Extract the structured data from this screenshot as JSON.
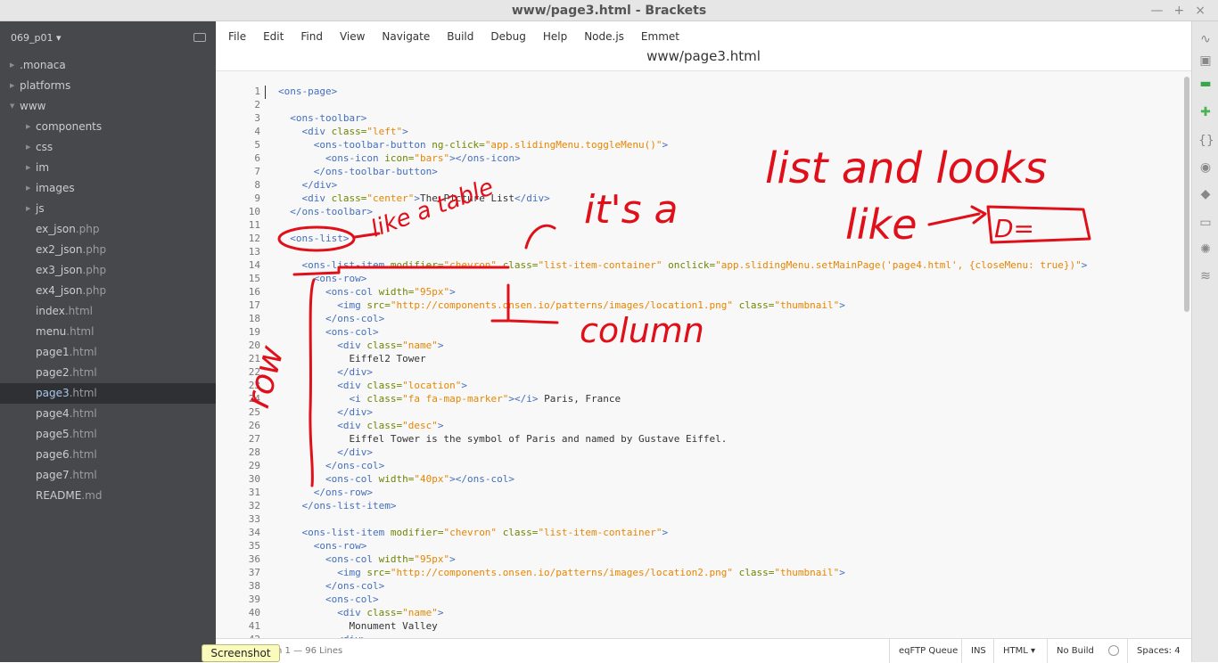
{
  "window": {
    "title": "www/page3.html - Brackets",
    "controls": [
      "—",
      "+",
      "×"
    ]
  },
  "sidebar": {
    "project": "069_p01 ▾",
    "items": [
      {
        "label": ".monaca",
        "type": "folder",
        "depth": 0,
        "open": false
      },
      {
        "label": "platforms",
        "type": "folder",
        "depth": 0,
        "open": false
      },
      {
        "label": "www",
        "type": "folder",
        "depth": 0,
        "open": true
      },
      {
        "label": "components",
        "type": "folder",
        "depth": 1,
        "open": false
      },
      {
        "label": "css",
        "type": "folder",
        "depth": 1,
        "open": false
      },
      {
        "label": "im",
        "type": "folder",
        "depth": 1,
        "open": false
      },
      {
        "label": "images",
        "type": "folder",
        "depth": 1,
        "open": false
      },
      {
        "label": "js",
        "type": "folder",
        "depth": 1,
        "open": false
      },
      {
        "name": "ex_json",
        "ext": ".php",
        "type": "file",
        "depth": 1
      },
      {
        "name": "ex2_json",
        "ext": ".php",
        "type": "file",
        "depth": 1
      },
      {
        "name": "ex3_json",
        "ext": ".php",
        "type": "file",
        "depth": 1
      },
      {
        "name": "ex4_json",
        "ext": ".php",
        "type": "file",
        "depth": 1
      },
      {
        "name": "index",
        "ext": ".html",
        "type": "file",
        "depth": 1
      },
      {
        "name": "menu",
        "ext": ".html",
        "type": "file",
        "depth": 1
      },
      {
        "name": "page1",
        "ext": ".html",
        "type": "file",
        "depth": 1
      },
      {
        "name": "page2",
        "ext": ".html",
        "type": "file",
        "depth": 1
      },
      {
        "name": "page3",
        "ext": ".html",
        "type": "file",
        "depth": 1,
        "selected": true
      },
      {
        "name": "page4",
        "ext": ".html",
        "type": "file",
        "depth": 1
      },
      {
        "name": "page5",
        "ext": ".html",
        "type": "file",
        "depth": 1
      },
      {
        "name": "page6",
        "ext": ".html",
        "type": "file",
        "depth": 1
      },
      {
        "name": "page7",
        "ext": ".html",
        "type": "file",
        "depth": 1
      },
      {
        "name": "README",
        "ext": ".md",
        "type": "file",
        "depth": 1
      }
    ]
  },
  "menu": [
    "File",
    "Edit",
    "Find",
    "View",
    "Navigate",
    "Build",
    "Debug",
    "Help",
    "Node.js",
    "Emmet"
  ],
  "file_title": "www/page3.html",
  "code": [
    [
      [
        "t",
        "<ons-page>"
      ]
    ],
    [],
    [
      [
        "p",
        "  "
      ],
      [
        "t",
        "<ons-toolbar>"
      ]
    ],
    [
      [
        "p",
        "    "
      ],
      [
        "t",
        "<div "
      ],
      [
        "a",
        "class="
      ],
      [
        "v",
        "\"left\""
      ],
      [
        "t",
        ">"
      ]
    ],
    [
      [
        "p",
        "      "
      ],
      [
        "t",
        "<ons-toolbar-button "
      ],
      [
        "a",
        "ng-click="
      ],
      [
        "v",
        "\"app.slidingMenu.toggleMenu()\""
      ],
      [
        "t",
        ">"
      ]
    ],
    [
      [
        "p",
        "        "
      ],
      [
        "t",
        "<ons-icon "
      ],
      [
        "a",
        "icon="
      ],
      [
        "v",
        "\"bars\""
      ],
      [
        "t",
        "></ons-icon>"
      ]
    ],
    [
      [
        "p",
        "      "
      ],
      [
        "t",
        "</ons-toolbar-button>"
      ]
    ],
    [
      [
        "p",
        "    "
      ],
      [
        "t",
        "</div>"
      ]
    ],
    [
      [
        "p",
        "    "
      ],
      [
        "t",
        "<div "
      ],
      [
        "a",
        "class="
      ],
      [
        "v",
        "\"center\""
      ],
      [
        "t",
        ">"
      ],
      [
        "p",
        "The Picture List"
      ],
      [
        "t",
        "</div>"
      ]
    ],
    [
      [
        "p",
        "  "
      ],
      [
        "t",
        "</ons-toolbar>"
      ]
    ],
    [],
    [
      [
        "p",
        "  "
      ],
      [
        "t",
        "<ons-list>"
      ]
    ],
    [],
    [
      [
        "p",
        "    "
      ],
      [
        "t",
        "<ons-list-item "
      ],
      [
        "a",
        "modifier="
      ],
      [
        "v",
        "\"chevron\""
      ],
      [
        "p",
        " "
      ],
      [
        "a",
        "class="
      ],
      [
        "v",
        "\"list-item-container\""
      ],
      [
        "p",
        " "
      ],
      [
        "a",
        "onclick="
      ],
      [
        "v",
        "\"app.slidingMenu.setMainPage('page4.html', {closeMenu: true})\""
      ],
      [
        "t",
        ">"
      ]
    ],
    [
      [
        "p",
        "      "
      ],
      [
        "t",
        "<ons-row>"
      ]
    ],
    [
      [
        "p",
        "        "
      ],
      [
        "t",
        "<ons-col "
      ],
      [
        "a",
        "width="
      ],
      [
        "v",
        "\"95px\""
      ],
      [
        "t",
        ">"
      ]
    ],
    [
      [
        "p",
        "          "
      ],
      [
        "t",
        "<img "
      ],
      [
        "a",
        "src="
      ],
      [
        "v",
        "\"http://components.onsen.io/patterns/images/location1.png\""
      ],
      [
        "p",
        " "
      ],
      [
        "a",
        "class="
      ],
      [
        "v",
        "\"thumbnail\""
      ],
      [
        "t",
        ">"
      ]
    ],
    [
      [
        "p",
        "        "
      ],
      [
        "t",
        "</ons-col>"
      ]
    ],
    [
      [
        "p",
        "        "
      ],
      [
        "t",
        "<ons-col>"
      ]
    ],
    [
      [
        "p",
        "          "
      ],
      [
        "t",
        "<div "
      ],
      [
        "a",
        "class="
      ],
      [
        "v",
        "\"name\""
      ],
      [
        "t",
        ">"
      ]
    ],
    [
      [
        "p",
        "            Eiffel2 Tower"
      ]
    ],
    [
      [
        "p",
        "          "
      ],
      [
        "t",
        "</div>"
      ]
    ],
    [
      [
        "p",
        "          "
      ],
      [
        "t",
        "<div "
      ],
      [
        "a",
        "class="
      ],
      [
        "v",
        "\"location\""
      ],
      [
        "t",
        ">"
      ]
    ],
    [
      [
        "p",
        "            "
      ],
      [
        "t",
        "<i "
      ],
      [
        "a",
        "class="
      ],
      [
        "v",
        "\"fa fa-map-marker\""
      ],
      [
        "t",
        "></i>"
      ],
      [
        "p",
        " Paris, France"
      ]
    ],
    [
      [
        "p",
        "          "
      ],
      [
        "t",
        "</div>"
      ]
    ],
    [
      [
        "p",
        "          "
      ],
      [
        "t",
        "<div "
      ],
      [
        "a",
        "class="
      ],
      [
        "v",
        "\"desc\""
      ],
      [
        "t",
        ">"
      ]
    ],
    [
      [
        "p",
        "            Eiffel Tower is the symbol of Paris and named by Gustave Eiffel."
      ]
    ],
    [
      [
        "p",
        "          "
      ],
      [
        "t",
        "</div>"
      ]
    ],
    [
      [
        "p",
        "        "
      ],
      [
        "t",
        "</ons-col>"
      ]
    ],
    [
      [
        "p",
        "        "
      ],
      [
        "t",
        "<ons-col "
      ],
      [
        "a",
        "width="
      ],
      [
        "v",
        "\"40px\""
      ],
      [
        "t",
        "></ons-col>"
      ]
    ],
    [
      [
        "p",
        "      "
      ],
      [
        "t",
        "</ons-row>"
      ]
    ],
    [
      [
        "p",
        "    "
      ],
      [
        "t",
        "</ons-list-item>"
      ]
    ],
    [],
    [
      [
        "p",
        "    "
      ],
      [
        "t",
        "<ons-list-item "
      ],
      [
        "a",
        "modifier="
      ],
      [
        "v",
        "\"chevron\""
      ],
      [
        "p",
        " "
      ],
      [
        "a",
        "class="
      ],
      [
        "v",
        "\"list-item-container\""
      ],
      [
        "t",
        ">"
      ]
    ],
    [
      [
        "p",
        "      "
      ],
      [
        "t",
        "<ons-row>"
      ]
    ],
    [
      [
        "p",
        "        "
      ],
      [
        "t",
        "<ons-col "
      ],
      [
        "a",
        "width="
      ],
      [
        "v",
        "\"95px\""
      ],
      [
        "t",
        ">"
      ]
    ],
    [
      [
        "p",
        "          "
      ],
      [
        "t",
        "<img "
      ],
      [
        "a",
        "src="
      ],
      [
        "v",
        "\"http://components.onsen.io/patterns/images/location2.png\""
      ],
      [
        "p",
        " "
      ],
      [
        "a",
        "class="
      ],
      [
        "v",
        "\"thumbnail\""
      ],
      [
        "t",
        ">"
      ]
    ],
    [
      [
        "p",
        "        "
      ],
      [
        "t",
        "</ons-col>"
      ]
    ],
    [
      [
        "p",
        "        "
      ],
      [
        "t",
        "<ons-col>"
      ]
    ],
    [
      [
        "p",
        "          "
      ],
      [
        "t",
        "<div "
      ],
      [
        "a",
        "class="
      ],
      [
        "v",
        "\"name\""
      ],
      [
        "t",
        ">"
      ]
    ],
    [
      [
        "p",
        "            Monument Valley"
      ]
    ],
    [
      [
        "p",
        "          "
      ],
      [
        "t",
        "<div>"
      ]
    ]
  ],
  "status": {
    "position": "n 1",
    "lines": "— 96 Lines",
    "ftp": "eqFTP Queue",
    "mode": "INS",
    "language": "HTML ▾",
    "build": "No Build",
    "spaces": "Spaces: 4"
  },
  "screenshot_button": "Screenshot",
  "annotations": {
    "a1": "like a table",
    "a2": "it's a",
    "a3": "list and looks",
    "a4": "like",
    "a5": "D=",
    "a6": "column",
    "a7": "row"
  },
  "colors": {
    "sidebar": "#47484b",
    "tag": "#446fbd",
    "attr": "#6d8600",
    "value": "#e88501",
    "ink": "#e0101a"
  }
}
